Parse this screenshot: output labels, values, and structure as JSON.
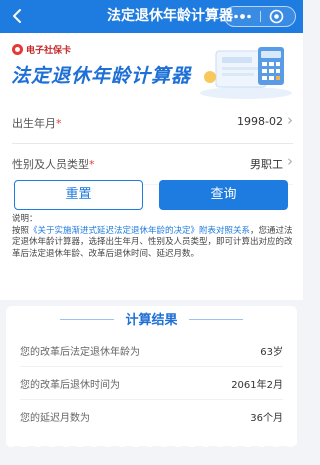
{
  "navbar": {
    "back_icon": "chevron-left-icon",
    "title": "法定退休年龄计算器",
    "more_icon": "ellipsis-icon",
    "close_icon": "target-close-icon",
    "bg_color": "#1e7be0"
  },
  "header": {
    "logo_text": "电子社保卡",
    "title": "法定退休年龄计算器"
  },
  "form": {
    "birth": {
      "label": "出生年月",
      "required": "*",
      "value": "1998-02"
    },
    "type": {
      "label": "性别及人员类型",
      "required": "*",
      "value": "男职工"
    }
  },
  "buttons": {
    "reset": "重置",
    "query": "查询"
  },
  "note": {
    "heading": "说明：",
    "prefix": "按照",
    "link": "《关于实施渐进式延迟法定退休年龄的决定》附表对照关系",
    "body": "，您通过法定退休年龄计算器，选择出生年月、性别及人员类型，即可计算出对应的改革后法定退休年龄、改革后退休时间、延迟月数。"
  },
  "result": {
    "title": "计算结果",
    "rows": [
      {
        "label": "您的改革后法定退休年龄为",
        "value": "63岁"
      },
      {
        "label": "您的改革后退休时间为",
        "value": "2061年2月"
      },
      {
        "label": "您的延迟月数为",
        "value": "36个月"
      }
    ]
  },
  "colors": {
    "accent": "#1e7be0",
    "required": "#e53935",
    "logo": "#c62828"
  }
}
